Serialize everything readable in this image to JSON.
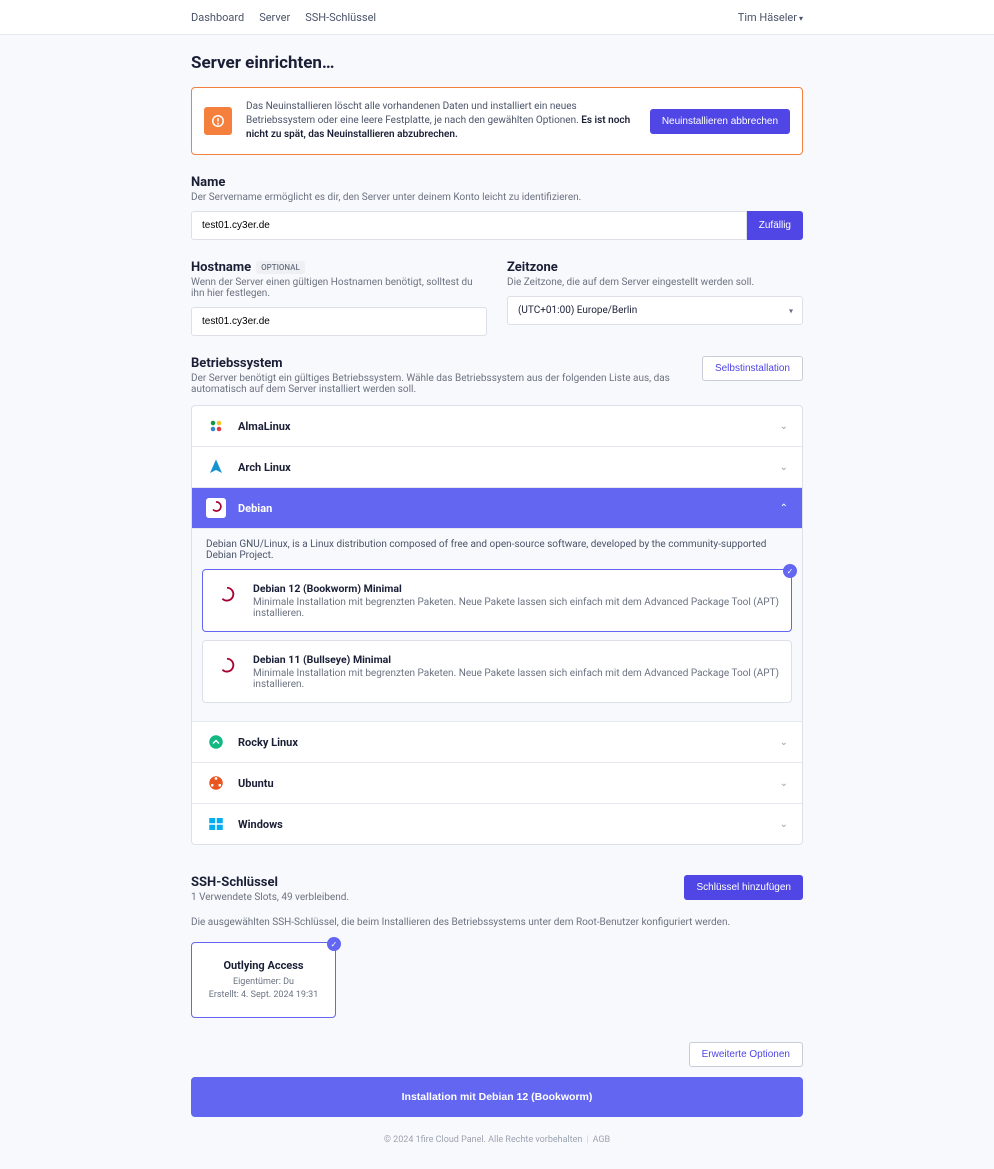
{
  "nav": {
    "dashboard": "Dashboard",
    "server": "Server",
    "ssh": "SSH-Schlüssel",
    "user": "Tim Häseler"
  },
  "page_title": "Server einrichten…",
  "alert": {
    "text_a": "Das Neuinstallieren löscht alle vorhandenen Daten und installiert ein neues Betriebssystem oder eine leere Festplatte, je nach den gewählten Optionen. ",
    "text_b": "Es ist noch nicht zu spät, das Neuinstallieren abzubrechen.",
    "button": "Neuinstallieren abbrechen"
  },
  "name": {
    "label": "Name",
    "desc": "Der Servername ermöglicht es dir, den Server unter deinem Konto leicht zu identifizieren.",
    "value": "test01.cy3er.de",
    "random_btn": "Zufällig"
  },
  "hostname": {
    "label": "Hostname",
    "optional": "OPTIONAL",
    "desc": "Wenn der Server einen gültigen Hostnamen benötigt, solltest du ihn hier festlegen.",
    "value": "test01.cy3er.de"
  },
  "timezone": {
    "label": "Zeitzone",
    "desc": "Die Zeitzone, die auf dem Server eingestellt werden soll.",
    "value": "(UTC+01:00) Europe/Berlin"
  },
  "os": {
    "label": "Betriebssystem",
    "desc": "Der Server benötigt ein gültiges Betriebssystem. Wähle das Betriebssystem aus der folgenden Liste aus, das automatisch auf dem Server installiert werden soll.",
    "self_install": "Selbstinstallation",
    "items": {
      "almalinux": "AlmaLinux",
      "archlinux": "Arch Linux",
      "debian": "Debian",
      "rocky": "Rocky Linux",
      "ubuntu": "Ubuntu",
      "windows": "Windows"
    },
    "debian_desc": "Debian GNU/Linux, is a Linux distribution composed of free and open-source software, developed by the community-supported Debian Project.",
    "debian_options": [
      {
        "title": "Debian 12 (Bookworm) Minimal",
        "desc": "Minimale Installation mit begrenzten Paketen. Neue Pakete lassen sich einfach mit dem Advanced Package Tool (APT) installieren."
      },
      {
        "title": "Debian 11 (Bullseye) Minimal",
        "desc": "Minimale Installation mit begrenzten Paketen. Neue Pakete lassen sich einfach mit dem Advanced Package Tool (APT) installieren."
      }
    ]
  },
  "ssh": {
    "label": "SSH-Schlüssel",
    "sub": "1 Verwendete Slots, 49 verbleibend.",
    "add_btn": "Schlüssel hinzufügen",
    "desc": "Die ausgewählten SSH-Schlüssel, die beim Installieren des Betriebssystems unter dem Root-Benutzer konfiguriert werden.",
    "key": {
      "name": "Outlying Access",
      "owner": "Eigentümer: Du",
      "created": "Erstellt: 4. Sept. 2024 19:31"
    }
  },
  "advanced_btn": "Erweiterte Optionen",
  "install_btn": "Installation mit Debian 12 (Bookworm)",
  "footer": {
    "copyright": "© 2024 1fire Cloud Panel. Alle Rechte vorbehalten",
    "agb": "AGB"
  }
}
